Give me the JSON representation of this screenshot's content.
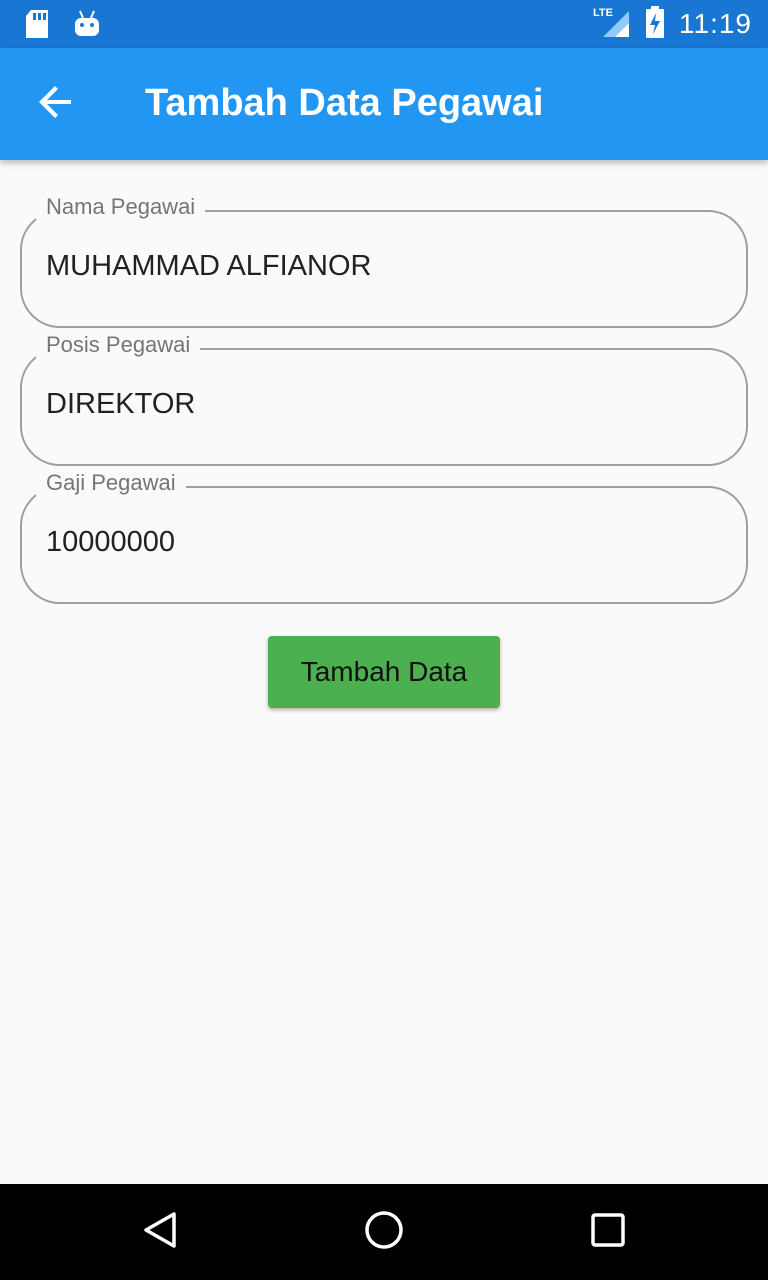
{
  "status_bar": {
    "time": "11:19",
    "network": "LTE",
    "icons": [
      "sd-card-icon",
      "android-debug-icon",
      "lte-signal-icon",
      "battery-charging-icon"
    ]
  },
  "app_bar": {
    "title": "Tambah Data Pegawai",
    "back_icon": "arrow-back-icon"
  },
  "form": {
    "fields": [
      {
        "label": "Nama Pegawai",
        "value": "MUHAMMAD ALFIANOR"
      },
      {
        "label": "Posis Pegawai",
        "value": "DIREKTOR"
      },
      {
        "label": "Gaji Pegawai",
        "value": "10000000"
      }
    ],
    "submit_label": "Tambah Data"
  },
  "nav_bar": {
    "icons": [
      "back-triangle-icon",
      "home-circle-icon",
      "recents-square-icon"
    ]
  },
  "colors": {
    "status_bar": "#1976d2",
    "app_bar": "#2196f3",
    "button": "#4caf50",
    "background": "#fafafa"
  }
}
